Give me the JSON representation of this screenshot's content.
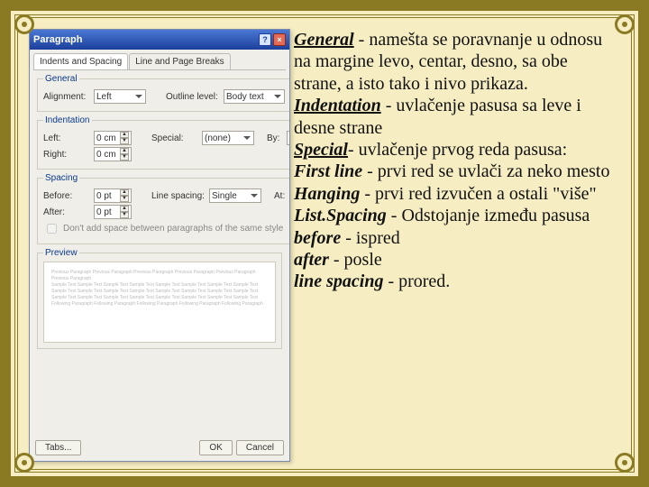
{
  "dialog": {
    "title": "Paragraph",
    "tabs": {
      "t1": "Indents and Spacing",
      "t2": "Line and Page Breaks"
    },
    "general": {
      "legend": "General",
      "alignment_lbl": "Alignment:",
      "alignment_val": "Left",
      "outline_lbl": "Outline level:",
      "outline_val": "Body text"
    },
    "indent": {
      "legend": "Indentation",
      "left_lbl": "Left:",
      "left_val": "0 cm",
      "right_lbl": "Right:",
      "right_val": "0 cm",
      "special_lbl": "Special:",
      "special_val": "(none)",
      "by_lbl": "By:"
    },
    "spacing": {
      "legend": "Spacing",
      "before_lbl": "Before:",
      "before_val": "0 pt",
      "after_lbl": "After:",
      "after_val": "0 pt",
      "ls_lbl": "Line spacing:",
      "ls_val": "Single",
      "at_lbl": "At:"
    },
    "chk_label": "Don't add space between paragraphs of the same style",
    "preview_legend": "Preview",
    "btn_tabs": "Tabs...",
    "btn_ok": "OK",
    "btn_cancel": "Cancel"
  },
  "notes": {
    "t1a": "General",
    "t1b": " - namešta se poravnanje u odnosu na margine levo, centar, desno, sa obe strane, a isto tako i nivo prikaza.",
    "t2a": "Indentation",
    "t2b": " - uvlačenje pasusa sa leve i desne strane",
    "t3a": "Special",
    "t3b": "- uvlačenje prvog reda pasusa:",
    "t4a": "First line",
    "t4b": " - prvi red se uvlači za neko mesto",
    "t5a": "Hanging",
    "t5b": " - prvi red izvučen a ostali \"više\"",
    "t6a": "List.Spacing",
    "t6b": " - Odstojanje između pasusa",
    "t7a": "before",
    "t7b": " - ispred",
    "t8a": "after",
    "t8b": " - posle",
    "t9a": "line spacing",
    "t9b": " - prored."
  }
}
